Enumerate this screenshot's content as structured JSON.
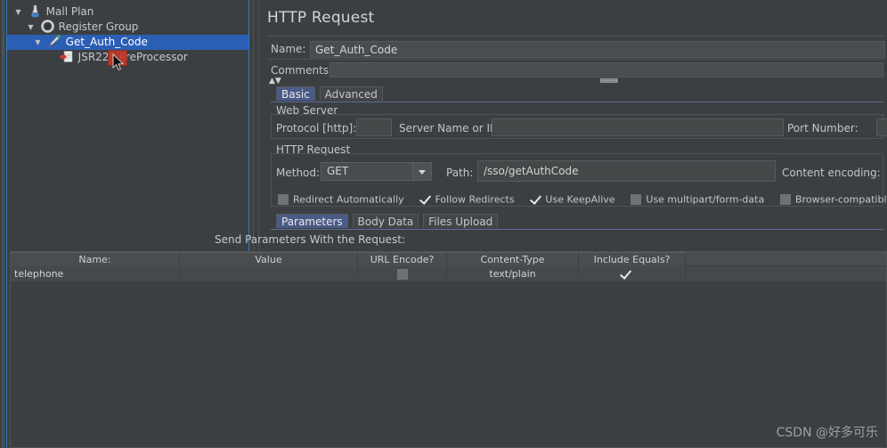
{
  "colors": {
    "bg": "#3c3f41",
    "selection": "#2b5fb5",
    "accent_border": "#2e7ac0",
    "tab_active": "#4b5b87",
    "field_bg": "#4a4d4f",
    "drag_marker": "#c0392b"
  },
  "tree": {
    "items": [
      {
        "label": "Mall Plan",
        "icon": "test-plan-icon",
        "depth": 0,
        "expanded": true,
        "selected": false
      },
      {
        "label": "Register Group",
        "icon": "thread-group-icon",
        "depth": 1,
        "expanded": true,
        "selected": false
      },
      {
        "label": "Get_Auth_Code",
        "icon": "http-sampler-icon",
        "depth": 2,
        "expanded": true,
        "selected": true
      },
      {
        "label": "JSR223 PreProcessor",
        "icon": "preprocessor-icon",
        "depth": 3,
        "expanded": false,
        "selected": false
      }
    ]
  },
  "panel": {
    "title": "HTTP Request",
    "name_label": "Name:",
    "name_value": "Get_Auth_Code",
    "comments_label": "Comments:",
    "comments_value": "",
    "tabs": [
      {
        "label": "Basic",
        "active": true
      },
      {
        "label": "Advanced",
        "active": false
      }
    ],
    "web_server": {
      "section_title": "Web Server",
      "protocol_label": "Protocol [http]:",
      "protocol_value": "",
      "server_label": "Server Name or IP:",
      "server_value": "",
      "port_label": "Port Number:",
      "port_value": ""
    },
    "http_request": {
      "section_title": "HTTP Request",
      "method_label": "Method:",
      "method_value": "GET",
      "path_label": "Path:",
      "path_value": "/sso/getAuthCode",
      "content_encoding_label": "Content encoding:",
      "content_encoding_value": "",
      "options": [
        {
          "label": "Redirect Automatically",
          "checked": false
        },
        {
          "label": "Follow Redirects",
          "checked": true
        },
        {
          "label": "Use KeepAlive",
          "checked": true
        },
        {
          "label": "Use multipart/form-data",
          "checked": false
        },
        {
          "label": "Browser-compatible headers",
          "checked": false
        }
      ]
    },
    "param_tabs": [
      {
        "label": "Parameters",
        "active": true
      },
      {
        "label": "Body Data",
        "active": false
      },
      {
        "label": "Files Upload",
        "active": false
      }
    ],
    "parameters": {
      "caption": "Send Parameters With the Request:",
      "columns": [
        "Name:",
        "Value",
        "URL Encode?",
        "Content-Type",
        "Include Equals?"
      ],
      "rows": [
        {
          "name": "telephone",
          "value": "",
          "url_encode": false,
          "content_type": "text/plain",
          "include_equals": true
        }
      ]
    }
  },
  "watermark": "CSDN @好多可乐"
}
